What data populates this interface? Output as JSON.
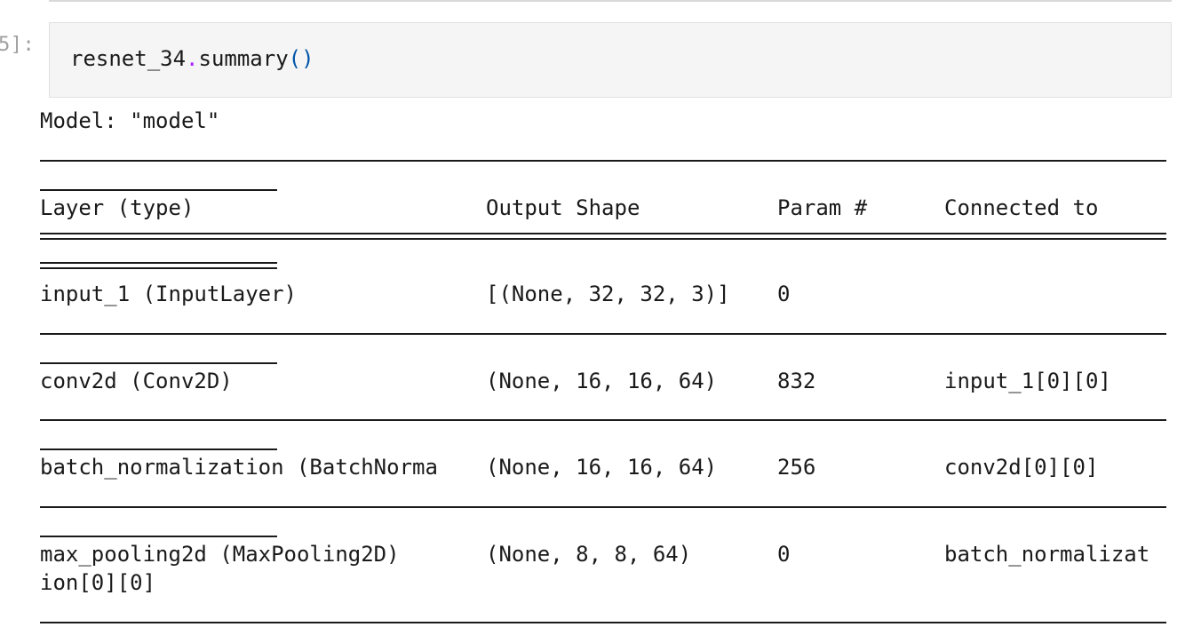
{
  "cell": {
    "prompt": "5]:",
    "code": {
      "obj": "resnet_34",
      "dot": ".",
      "method": "summary",
      "parens": "()"
    }
  },
  "output": {
    "model_line": "Model: \"model\"",
    "headers": {
      "layer": "Layer (type)",
      "shape": "Output Shape",
      "params": "Param #",
      "connected": "Connected to"
    },
    "rows": [
      {
        "layer": "input_1 (InputLayer)",
        "shape": "[(None, 32, 32, 3)]",
        "params": "0",
        "connected": ""
      },
      {
        "layer": "conv2d (Conv2D)",
        "shape": "(None, 16, 16, 64)",
        "params": "832",
        "connected": "input_1[0][0]"
      },
      {
        "layer": "batch_normalization (BatchNorma",
        "shape": "(None, 16, 16, 64)",
        "params": "256",
        "connected": "conv2d[0][0]"
      },
      {
        "layer": "max_pooling2d (MaxPooling2D)",
        "shape": "(None, 8, 8, 64)",
        "params": "0",
        "connected": "batch_normalizat",
        "wrap": "ion[0][0]"
      }
    ]
  }
}
